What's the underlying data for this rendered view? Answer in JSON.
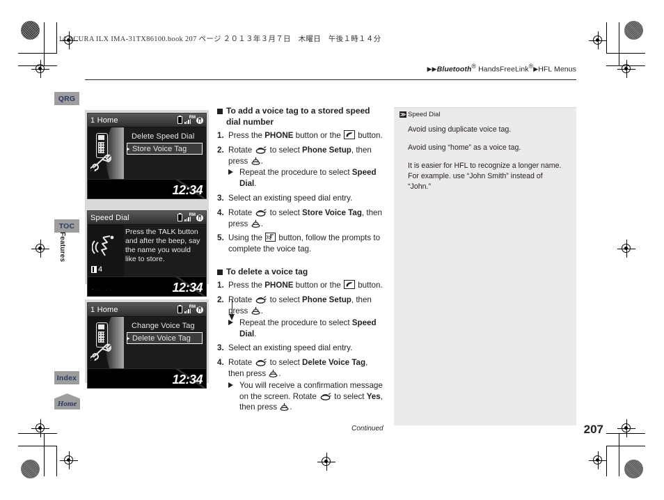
{
  "book_header": "14 ACURA ILX IMA-31TX86100.book  207 ページ  ２０１３年３月７日　木曜日　午後１時１４分",
  "breadcrumb": {
    "arrow1": "▶▶",
    "part1": "Bluetooth",
    "sup1": "®",
    "part2": " HandsFreeLink",
    "sup2": "®",
    "arrow2": "▶",
    "part3": "HFL Menus"
  },
  "sidebar": {
    "tabs": [
      {
        "label": "QRG",
        "name": "qrg"
      },
      {
        "label": "TOC",
        "name": "toc"
      },
      {
        "label": "Index",
        "name": "index"
      }
    ],
    "home_label": "Home",
    "section_label": "Features"
  },
  "screens": [
    {
      "title": "1 Home",
      "type": "menu",
      "items": [
        {
          "label": "Delete Speed Dial",
          "selected": false
        },
        {
          "label": "Store Voice Tag",
          "selected": true
        }
      ],
      "clock": "12:34",
      "status_icons": [
        "battery-icon",
        "signal-icon",
        "roaming-label",
        "bluetooth-icon"
      ],
      "roaming": "RM",
      "bluetooth_glyph": "ᛗ"
    },
    {
      "title": "Speed Dial",
      "type": "message",
      "message": "Press the TALK button and after the beep, say the name you would like to store.",
      "badge": "4",
      "clock": "12:34",
      "roaming": "RM",
      "bluetooth_glyph": "ᛗ"
    },
    {
      "title": "1 Home",
      "type": "menu",
      "items": [
        {
          "label": "Change Voice Tag",
          "selected": false
        },
        {
          "label": "Delete Voice Tag",
          "selected": true
        }
      ],
      "clock": "12:34",
      "roaming": "RM",
      "bluetooth_glyph": "ᛗ"
    }
  ],
  "sections": [
    {
      "heading": "To add a voice tag to a stored speed dial number",
      "steps": [
        {
          "num": "1.",
          "parts": [
            {
              "t": "Press the "
            },
            {
              "t": "PHONE",
              "b": true
            },
            {
              "t": " button or the "
            },
            {
              "icon": "pickup-phone-icon"
            },
            {
              "t": " button."
            }
          ]
        },
        {
          "num": "2.",
          "parts": [
            {
              "t": "Rotate "
            },
            {
              "icon": "rotary-dial-icon"
            },
            {
              "t": " to select "
            },
            {
              "t": "Phone Setup",
              "b": true
            },
            {
              "t": ", then press "
            },
            {
              "icon": "enter-press-icon"
            },
            {
              "t": "."
            }
          ],
          "sub": [
            {
              "t": "Repeat the procedure to select "
            },
            {
              "t": "Speed Dial",
              "b": true
            },
            {
              "t": "."
            }
          ]
        },
        {
          "num": "3.",
          "parts": [
            {
              "t": "Select an existing speed dial entry."
            }
          ]
        },
        {
          "num": "4.",
          "parts": [
            {
              "t": "Rotate "
            },
            {
              "icon": "rotary-dial-icon"
            },
            {
              "t": " to select "
            },
            {
              "t": "Store Voice Tag",
              "b": true
            },
            {
              "t": ", then press "
            },
            {
              "icon": "enter-press-icon"
            },
            {
              "t": "."
            }
          ]
        },
        {
          "num": "5.",
          "parts": [
            {
              "t": "Using the "
            },
            {
              "icon": "talk-button-icon"
            },
            {
              "t": " button, follow the prompts to complete the voice tag."
            }
          ]
        }
      ]
    },
    {
      "heading": "To delete a voice tag",
      "steps": [
        {
          "num": "1.",
          "parts": [
            {
              "t": "Press the "
            },
            {
              "t": "PHONE",
              "b": true
            },
            {
              "t": " button or the "
            },
            {
              "icon": "pickup-phone-icon"
            },
            {
              "t": " button."
            }
          ]
        },
        {
          "num": "2.",
          "parts": [
            {
              "t": "Rotate "
            },
            {
              "icon": "rotary-dial-icon"
            },
            {
              "t": " to select "
            },
            {
              "t": "Phone Setup",
              "b": true
            },
            {
              "t": ", then press "
            },
            {
              "icon": "enter-press-icon"
            },
            {
              "t": "."
            }
          ],
          "sub": [
            {
              "t": "Repeat the procedure to select "
            },
            {
              "t": "Speed Dial",
              "b": true
            },
            {
              "t": "."
            }
          ]
        },
        {
          "num": "3.",
          "parts": [
            {
              "t": "Select an existing speed dial entry."
            }
          ]
        },
        {
          "num": "4.",
          "parts": [
            {
              "t": "Rotate "
            },
            {
              "icon": "rotary-dial-icon"
            },
            {
              "t": " to select "
            },
            {
              "t": "Delete Voice Tag",
              "b": true
            },
            {
              "t": ", then press "
            },
            {
              "icon": "enter-press-icon"
            },
            {
              "t": "."
            }
          ],
          "sub": [
            {
              "t": "You will receive a confirmation message on the screen. Rotate "
            },
            {
              "icon": "rotary-dial-icon"
            },
            {
              "t": " to select "
            },
            {
              "t": "Yes",
              "b": true
            },
            {
              "t": ", then press "
            },
            {
              "icon": "enter-press-icon"
            },
            {
              "t": "."
            }
          ]
        }
      ]
    }
  ],
  "note": {
    "marker": "≫",
    "title": "Speed Dial",
    "paragraphs": [
      "Avoid using duplicate voice tag.",
      "Avoid using “home” as a voice tag.",
      "It is easier for HFL to recognize a longer name. For example. use “John Smith” instead of “John.”"
    ]
  },
  "footer": {
    "continued": "Continued",
    "page_number": "207"
  },
  "colors": {
    "tab_bg": "#9d9d9d",
    "tab_text": "#2a3b63",
    "note_bg": "#eceaea",
    "figure_bg": "#d9d9d9",
    "text": "#231f20"
  }
}
